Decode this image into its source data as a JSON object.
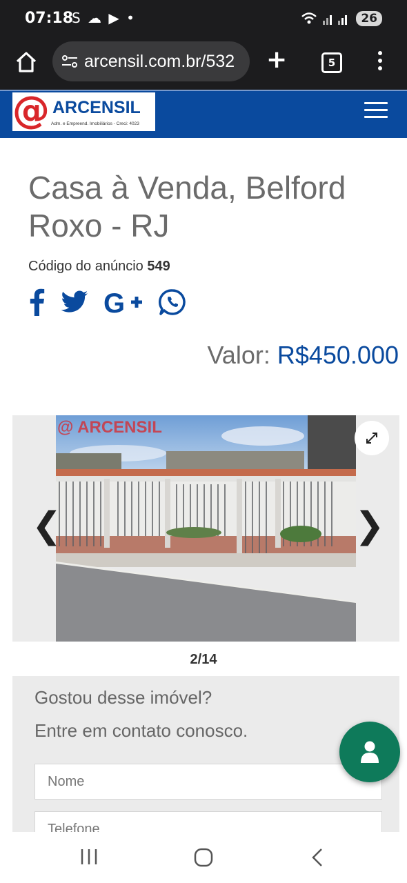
{
  "status_bar": {
    "time": "07:18",
    "notification_icons": "S ☁ ▶ •",
    "battery": "26"
  },
  "browser": {
    "url": "arcensil.com.br/532",
    "tab_count": "5"
  },
  "site": {
    "logo_symbol": "@",
    "logo_name": "ARCENSIL",
    "logo_tagline": "Adm. e Empreend. Imobiliários - Creci: 4023",
    "brand_color": "#0a4a9e"
  },
  "listing": {
    "title": "Casa à Venda, Belford Roxo - RJ",
    "code_label": "Código do anúncio",
    "code_value": "549",
    "price_label": "Valor:",
    "price_value": "R$450.000"
  },
  "social": [
    "facebook-icon",
    "twitter-icon",
    "google-plus-icon",
    "whatsapp-icon"
  ],
  "gallery": {
    "watermark": "@ ARCENSIL",
    "prev_label": "❮",
    "next_label": "❯",
    "counter": "2/14"
  },
  "contact": {
    "title": "Gostou desse imóvel?",
    "subtitle": "Entre em contato conosco.",
    "name_placeholder": "Nome",
    "phone_placeholder": "Telefone"
  }
}
